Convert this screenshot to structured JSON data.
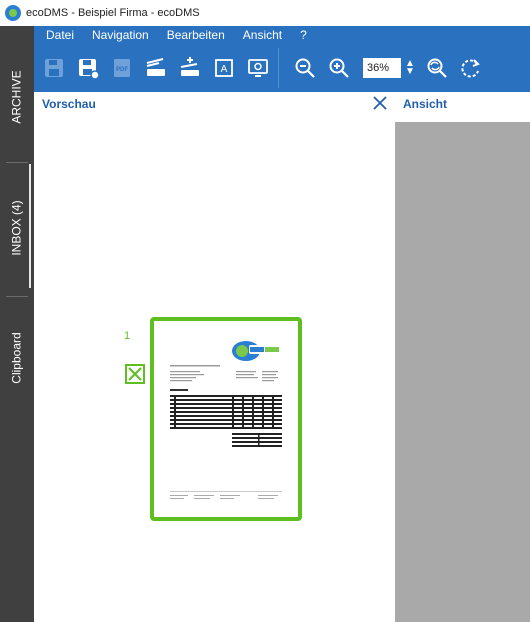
{
  "window": {
    "title": "ecoDMS - Beispiel Firma - ecoDMS"
  },
  "sidebar": {
    "tabs": [
      {
        "label": "ARCHIVE"
      },
      {
        "label": "INBOX (4)",
        "active": true
      },
      {
        "label": "Clipboard"
      }
    ]
  },
  "menu": {
    "items": [
      {
        "label": "Datei"
      },
      {
        "label": "Navigation"
      },
      {
        "label": "Bearbeiten"
      },
      {
        "label": "Ansicht"
      },
      {
        "label": "?"
      }
    ]
  },
  "toolbar": {
    "zoom_value": "36%",
    "icons": [
      "save-icon",
      "save-as-icon",
      "pdf-icon",
      "scan-icon",
      "scan-add-icon",
      "ocr-icon",
      "screen-capture-icon",
      "zoom-out-icon",
      "zoom-in-icon",
      "fit-page-icon",
      "rotate-icon"
    ]
  },
  "preview_panel": {
    "title": "Vorschau",
    "page_number": "1",
    "close_icon": "close-icon"
  },
  "view_panel": {
    "title": "Ansicht"
  },
  "colors": {
    "accent_blue": "#2a72c0",
    "sidebar_dark": "#404040",
    "selection_green": "#5fbf20",
    "panel_title_blue": "#1f5fad",
    "view_gray": "#a9a9a9"
  }
}
